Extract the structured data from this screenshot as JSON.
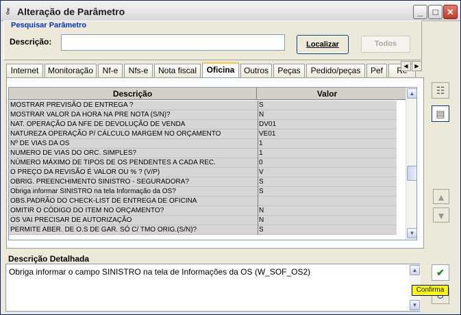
{
  "window": {
    "title": "Alteração de Parâmetro",
    "title_icon": "key-icon",
    "minimize": "_",
    "maximize": "□",
    "close": "✕"
  },
  "search": {
    "legend": "Pesquisar Parâmetro",
    "description_label": "Descrição:",
    "description_value": "",
    "localizar_label": "Localizar",
    "todos_label": "Todos"
  },
  "tabs": [
    {
      "label": "Internet"
    },
    {
      "label": "Monitoração"
    },
    {
      "label": "Nf-e"
    },
    {
      "label": "Nfs-e"
    },
    {
      "label": "Nota fiscal"
    },
    {
      "label": "Oficina"
    },
    {
      "label": "Outros"
    },
    {
      "label": "Peças"
    },
    {
      "label": "Pedido/peças"
    },
    {
      "label": "Pef"
    },
    {
      "label": "Re"
    }
  ],
  "active_tab": "Oficina",
  "grid": {
    "headers": {
      "description": "Descrição",
      "value": "Valor"
    },
    "rows": [
      {
        "description": "MOSTRAR PREVISÃO DE ENTREGA ?",
        "value": "S"
      },
      {
        "description": "MOSTRAR VALOR DA HORA NA PRE NOTA (S/N)?",
        "value": "N"
      },
      {
        "description": "NAT. OPERAÇÃO DA NFE DE DEVOLUÇÃO DE VENDA",
        "value": "DV01"
      },
      {
        "description": "NATUREZA OPERAÇÃO P/ CÁLCULO MARGEM NO ORÇAMENTO",
        "value": "VE01"
      },
      {
        "description": "Nº DE VIAS DA OS",
        "value": "1"
      },
      {
        "description": "NUMERO DE VIAS DO ORC. SIMPLES?",
        "value": "1"
      },
      {
        "description": "NÚMERO MÁXIMO DE TIPOS DE OS PENDENTES A CADA REC.",
        "value": "0"
      },
      {
        "description": "O PREÇO DA REVISÃO É VALOR OU % ? (V/P)",
        "value": "V"
      },
      {
        "description": "OBRIG. PREENCHIMENTO SINISTRO - SEGURADORA?",
        "value": "S"
      },
      {
        "description": "Obriga informar SINISTRO na tela Informação da OS?",
        "value": "S"
      },
      {
        "description": "OBS.PADRÃO DO CHECK-LIST DE ENTREGA DE OFICINA",
        "value": ""
      },
      {
        "description": "OMITIR O CÓDIGO DO ITEM NO ORÇAMENTO?",
        "value": "N"
      },
      {
        "description": "OS VAI PRECISAR DE AUTORIZAÇÃO",
        "value": "N"
      },
      {
        "description": "PERMITE ABER. DE O.S DE GAR. SÓ C/ TMO ORIG.(S/N)?",
        "value": "S"
      }
    ]
  },
  "detail": {
    "label": "Descrição Detalhada",
    "text": "Obriga informar o campo SINISTRO na tela de Informações da OS (W_SOF_OS2)"
  },
  "tooltip": "Confirma"
}
